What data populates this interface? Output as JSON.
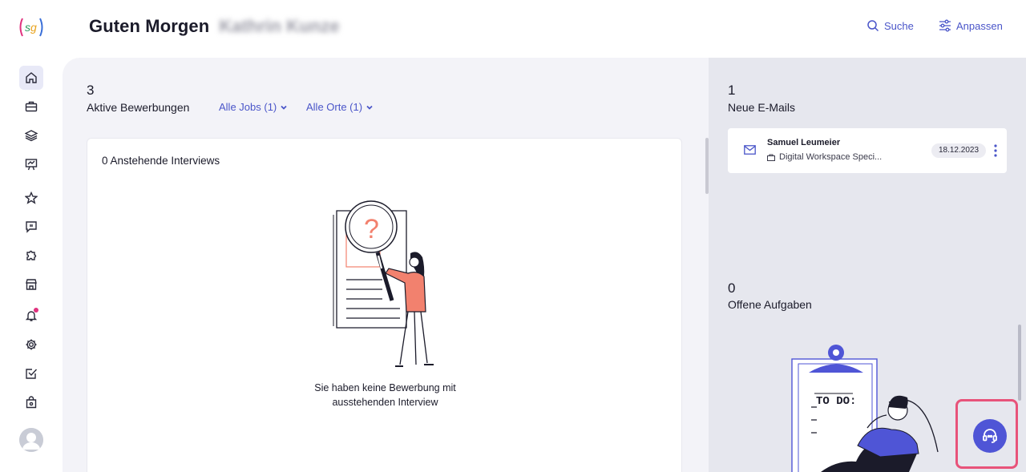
{
  "header": {
    "greeting": "Guten Morgen",
    "user_name": "Kathrin Kunze",
    "search_label": "Suche",
    "customize_label": "Anpassen"
  },
  "sidebar": {
    "items": [
      {
        "name": "home",
        "icon": "home-icon"
      },
      {
        "name": "jobs",
        "icon": "briefcase-icon"
      },
      {
        "name": "layers",
        "icon": "layers-icon"
      },
      {
        "name": "presentation",
        "icon": "presentation-icon"
      },
      {
        "name": "favorites",
        "icon": "star-icon"
      },
      {
        "name": "messages",
        "icon": "chat-icon"
      },
      {
        "name": "integrations",
        "icon": "puzzle-icon"
      },
      {
        "name": "store",
        "icon": "store-icon"
      },
      {
        "name": "notifications",
        "icon": "bell-icon"
      },
      {
        "name": "settings",
        "icon": "gear-icon"
      },
      {
        "name": "tasks",
        "icon": "checkbox-icon"
      },
      {
        "name": "shop",
        "icon": "bag-icon"
      }
    ]
  },
  "main": {
    "applications_count": "3",
    "applications_label": "Aktive Bewerbungen",
    "filter_jobs": "Alle Jobs (1)",
    "filter_locations": "Alle Orte (1)",
    "interviews_title": "0 Anstehende Interviews",
    "empty_line1": "Sie haben keine Bewerbung mit",
    "empty_line2": "ausstehenden Interview"
  },
  "right": {
    "emails_count": "1",
    "emails_label": "Neue E-Mails",
    "email": {
      "sender": "Samuel Leumeier",
      "subject": "Digital Workspace Speci...",
      "date": "18.12.2023"
    },
    "tasks_count": "0",
    "tasks_label": "Offene Aufgaben",
    "todo_text": "TO DO:"
  },
  "colors": {
    "accent": "#4a55c9",
    "support_button": "#4f55d6",
    "highlight_border": "#e8537a",
    "illustration_accent": "#f2816e"
  }
}
